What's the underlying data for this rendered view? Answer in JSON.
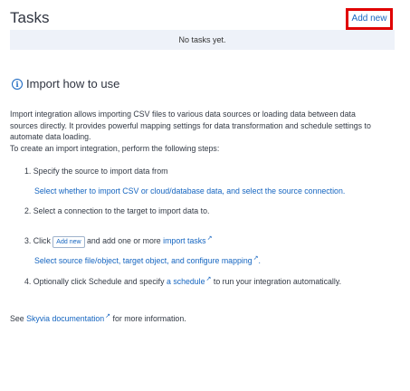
{
  "header": {
    "title": "Tasks",
    "add_new_label": "Add new"
  },
  "tasks": {
    "empty_text": "No tasks yet."
  },
  "howto": {
    "title": "Import how to use",
    "intro_line1": "Import integration allows importing CSV files to various data sources or loading data between data",
    "intro_line2": "sources directly. It provides powerful mapping settings for data transformation and schedule settings to",
    "intro_line3": "automate data loading.",
    "steps_intro": "To create an import integration, perform the following steps:",
    "step1": "1. Specify the source to import data from",
    "step1_sub": "Select whether to import CSV or cloud/database data, and select the source connection.",
    "step2": "2. Select a connection to the target to import data to.",
    "step3_prefix": "3. Click",
    "step3_button": "Add new",
    "step3_middle": "and add one or more",
    "step3_link": "import tasks",
    "step3_sub_prefix": "Select source file/object, target object, and configure",
    "step3_sub_link": "mapping",
    "step3_sub_suffix": ".",
    "step4_prefix": "4. Optionally click Schedule and specify",
    "step4_link": "a schedule",
    "step4_suffix": "to run your integration automatically.",
    "footer_prefix": "See",
    "footer_link": "Skyvia documentation",
    "footer_suffix": "for more information.",
    "external_link_icon": "external-link-icon",
    "info_icon": "info-icon"
  }
}
